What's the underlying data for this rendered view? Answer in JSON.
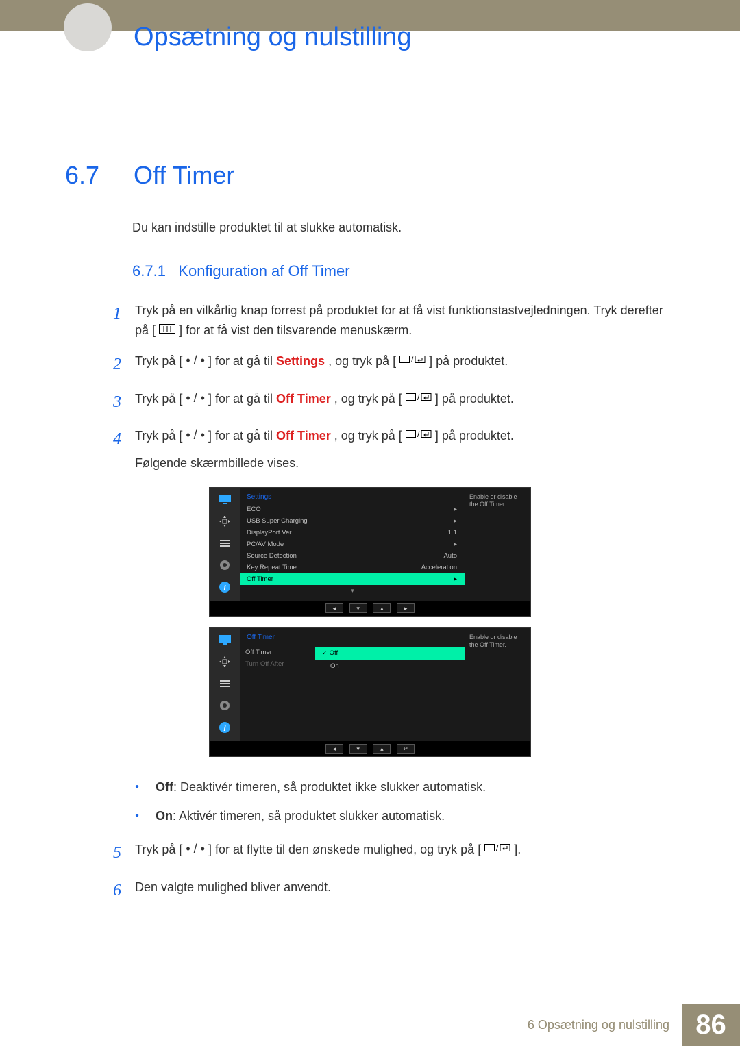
{
  "header": {
    "chapter_title": "Opsætning og nulstilling"
  },
  "section": {
    "number": "6.7",
    "title": "Off Timer"
  },
  "intro": "Du kan indstille produktet til at slukke automatisk.",
  "subsection": {
    "number": "6.7.1",
    "title": "Konfiguration af Off Timer"
  },
  "steps": {
    "s1": {
      "num": "1",
      "a": "Tryk på en vilkårlig knap forrest på produktet for at få vist funktionstastvejledningen. Tryk derefter på [",
      "b": "] for at få vist den tilsvarende menuskærm."
    },
    "s2": {
      "num": "2",
      "a": "Tryk på [",
      "b": "] for at gå til ",
      "settings": "Settings",
      "c": ", og tryk på [",
      "d": "] på produktet."
    },
    "s3": {
      "num": "3",
      "a": "Tryk på [",
      "b": "] for at gå til ",
      "off_timer": "Off Timer",
      "c": ", og tryk på [",
      "d": "] på produktet."
    },
    "s4": {
      "num": "4",
      "a": "Tryk på [",
      "b": "] for at gå til ",
      "off_timer": "Off Timer",
      "c": ", og tryk på [",
      "d": "] på produktet.",
      "e": "Følgende skærmbillede vises."
    },
    "s5": {
      "num": "5",
      "a": "Tryk på [",
      "b": "] for at flytte til den ønskede mulighed, og tryk på [",
      "c": "]."
    },
    "s6": {
      "num": "6",
      "a": "Den valgte mulighed bliver anvendt."
    }
  },
  "bullets": {
    "off_label": "Off",
    "off_text": ": Deaktivér timeren, så produktet ikke slukker automatisk.",
    "on_label": "On",
    "on_text": ": Aktivér timeren, så produktet slukker automatisk."
  },
  "osd1": {
    "title": "Settings",
    "help": "Enable or disable the Off Timer.",
    "rows": {
      "eco": "ECO",
      "usb": "USB Super Charging",
      "dp": "DisplayPort Ver.",
      "dp_val": "1.1",
      "pcav": "PC/AV Mode",
      "src": "Source Detection",
      "src_val": "Auto",
      "key": "Key Repeat Time",
      "key_val": "Acceleration",
      "off_timer": "Off Timer"
    }
  },
  "osd2": {
    "title": "Off Timer",
    "help": "Enable or disable the Off Timer.",
    "rows": {
      "off_timer": "Off Timer",
      "turn_off_after": "Turn Off After"
    },
    "opts": {
      "off": "Off",
      "on": "On"
    }
  },
  "footer": {
    "text": "6 Opsætning og nulstilling",
    "page": "86"
  }
}
